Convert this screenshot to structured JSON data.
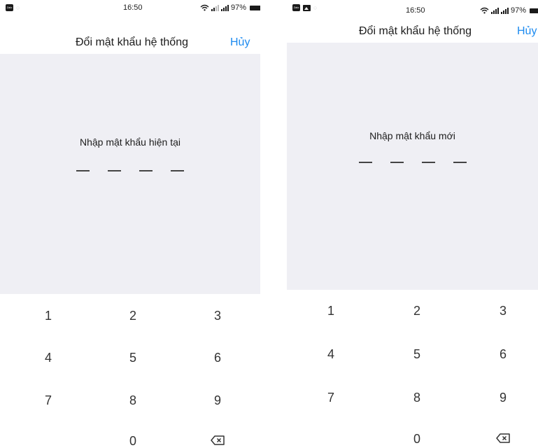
{
  "status_bar": {
    "time": "16:50",
    "battery_text": "97%",
    "app_icon_label": "Zalo",
    "icons": [
      "zalo-app-icon",
      "image-notification-icon",
      "wifi-icon",
      "signal-icon",
      "signal-icon",
      "battery-icon"
    ]
  },
  "screens": [
    {
      "header": {
        "title": "Đổi mật khẩu hệ thống",
        "cancel": "Hủy"
      },
      "prompt": "Nhập mật khẩu hiện tại",
      "pin_length": 4
    },
    {
      "header": {
        "title": "Đổi mật khẩu hệ thống",
        "cancel": "Hủy"
      },
      "prompt": "Nhập mật khẩu mới",
      "pin_length": 4
    }
  ],
  "keypad": {
    "keys": [
      "1",
      "2",
      "3",
      "4",
      "5",
      "6",
      "7",
      "8",
      "9",
      "0"
    ],
    "backspace_icon": "backspace-icon"
  },
  "colors": {
    "accent": "#1d8bf0",
    "panel_bg": "#efeff4"
  }
}
